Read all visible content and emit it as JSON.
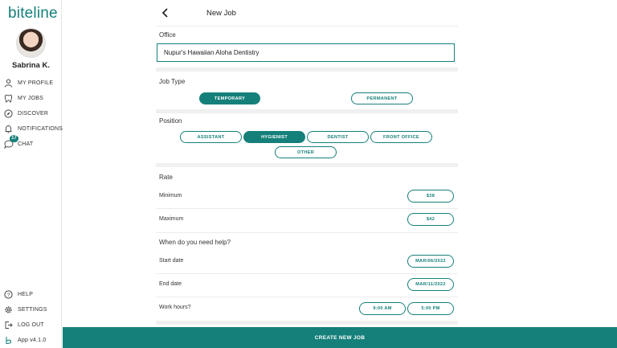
{
  "brand": {
    "name": "biteline"
  },
  "user": {
    "name": "Sabrina K."
  },
  "sidebar": {
    "items": [
      {
        "label": "MY PROFILE",
        "icon": "person-icon"
      },
      {
        "label": "MY JOBS",
        "icon": "tooth-icon"
      },
      {
        "label": "DISCOVER",
        "icon": "compass-icon"
      },
      {
        "label": "NOTIFICATIONS",
        "icon": "bell-icon"
      },
      {
        "label": "CHAT",
        "icon": "chat-icon",
        "badge": "17"
      }
    ],
    "bottom_items": [
      {
        "label": "HELP",
        "icon": "help-icon"
      },
      {
        "label": "SETTINGS",
        "icon": "gear-icon"
      },
      {
        "label": "LOG OUT",
        "icon": "logout-icon"
      },
      {
        "label": "App v4.1.0",
        "icon": "app-logo-icon"
      }
    ]
  },
  "header": {
    "title": "New Job"
  },
  "office": {
    "label": "Office",
    "value": "Nupur's Hawaiian Aloha Dentistry"
  },
  "job_type": {
    "label": "Job Type",
    "options": [
      "TEMPORARY",
      "PERMANENT"
    ],
    "selected": "TEMPORARY"
  },
  "position": {
    "label": "Position",
    "options": [
      "ASSISTANT",
      "HYGIENIST",
      "DENTIST",
      "FRONT OFFICE",
      "OTHER"
    ],
    "selected": "HYGIENIST"
  },
  "rate": {
    "label": "Rate",
    "minimum_label": "Minimum",
    "minimum_value": "$38",
    "maximum_label": "Maximum",
    "maximum_value": "$42"
  },
  "schedule": {
    "label": "When do you need help?",
    "start_label": "Start date",
    "start_value": "MAR/06/2022",
    "end_label": "End date",
    "end_value": "MAR/11/2022",
    "hours_label": "Work hours?",
    "hours_start": "9:00 AM",
    "hours_end": "5:00 PM"
  },
  "actions": {
    "create": "CREATE NEW JOB"
  },
  "colors": {
    "accent": "#15807a"
  }
}
